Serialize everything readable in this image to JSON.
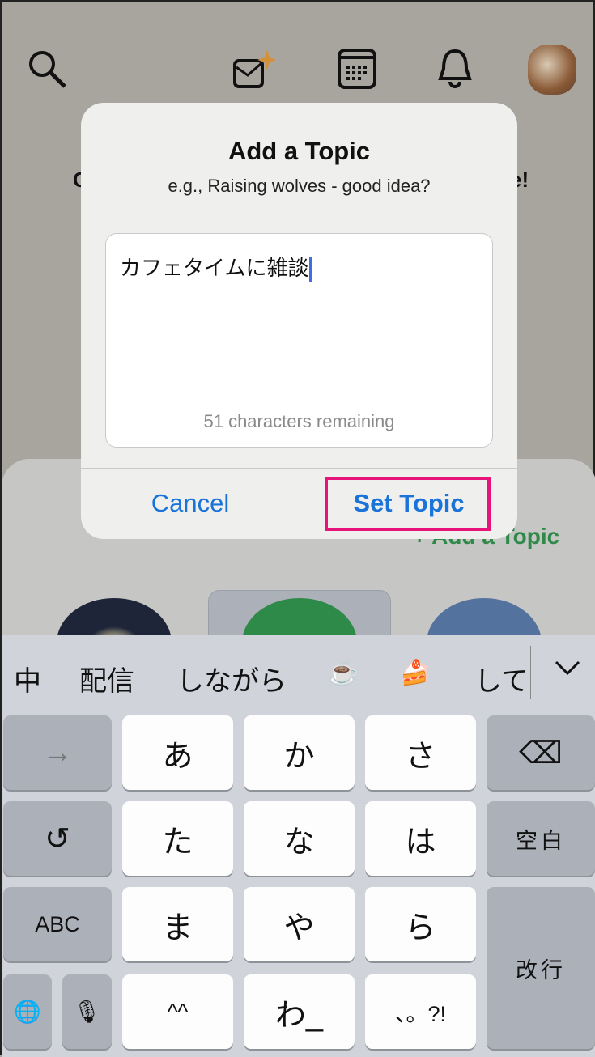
{
  "header": {
    "icons": [
      "search-icon",
      "ai-inbox-icon",
      "calendar-icon",
      "bell-icon",
      "avatar"
    ]
  },
  "background": {
    "text_left": "C",
    "text_right": "e!",
    "add_topic_link": "+ Add a Topic"
  },
  "dialog": {
    "title": "Add a Topic",
    "subtitle": "e.g., Raising wolves - good idea?",
    "input_value": "カフェタイムに雑談",
    "remaining": "51 characters remaining",
    "cancel": "Cancel",
    "set_topic": "Set Topic",
    "highlight_color": "#e6147a",
    "accent": "#1a73d9"
  },
  "keyboard": {
    "candidates": [
      "中",
      "配信",
      "しながら",
      "☕",
      "🍰",
      "して"
    ],
    "collapse_icon": "⌄",
    "keys": {
      "arrow": "→",
      "a": "あ",
      "ka": "か",
      "sa": "さ",
      "delete": "⌫",
      "undo": "↺",
      "ta": "た",
      "na": "な",
      "ha": "は",
      "space": "空白",
      "abc": "ABC",
      "ma": "ま",
      "ya": "や",
      "ra": "ら",
      "enter": "改行",
      "globe": "🌐",
      "mic": "🎙",
      "kaomoji": "^^",
      "wa": "わ_",
      "punct": "、。?!"
    }
  }
}
